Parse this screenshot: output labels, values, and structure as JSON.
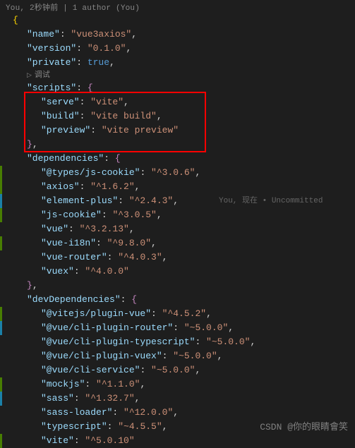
{
  "header": {
    "author_line": "You, 2秒钟前 | 1 author (You)"
  },
  "codelens": {
    "icon": "▷",
    "label": "调试"
  },
  "inline_blame": {
    "prefix": "You, 现在 ",
    "dot": "•",
    "suffix": " Uncommitted"
  },
  "json": {
    "name_key": "\"name\"",
    "name_val": "\"vue3axios\"",
    "version_key": "\"version\"",
    "version_val": "\"0.1.0\"",
    "private_key": "\"private\"",
    "private_val": "true",
    "scripts_key": "\"scripts\"",
    "serve_key": "\"serve\"",
    "serve_val": "\"vite\"",
    "build_key": "\"build\"",
    "build_val": "\"vite build\"",
    "preview_key": "\"preview\"",
    "preview_val": "\"vite preview\"",
    "dependencies_key": "\"dependencies\"",
    "dep_types_js_cookie_key": "\"@types/js-cookie\"",
    "dep_types_js_cookie_val": "\"^3.0.6\"",
    "dep_axios_key": "\"axios\"",
    "dep_axios_val": "\"^1.6.2\"",
    "dep_element_plus_key": "\"element-plus\"",
    "dep_element_plus_val": "\"^2.4.3\"",
    "dep_js_cookie_key": "\"js-cookie\"",
    "dep_js_cookie_val": "\"^3.0.5\"",
    "dep_vue_key": "\"vue\"",
    "dep_vue_val": "\"^3.2.13\"",
    "dep_vue_i18n_key": "\"vue-i18n\"",
    "dep_vue_i18n_val": "\"^9.8.0\"",
    "dep_vue_router_key": "\"vue-router\"",
    "dep_vue_router_val": "\"^4.0.3\"",
    "dep_vuex_key": "\"vuex\"",
    "dep_vuex_val": "\"^4.0.0\"",
    "devDependencies_key": "\"devDependencies\"",
    "dev_vitejs_plugin_vue_key": "\"@vitejs/plugin-vue\"",
    "dev_vitejs_plugin_vue_val": "\"^4.5.2\"",
    "dev_cli_plugin_router_key": "\"@vue/cli-plugin-router\"",
    "dev_cli_plugin_router_val": "\"~5.0.0\"",
    "dev_cli_plugin_typescript_key": "\"@vue/cli-plugin-typescript\"",
    "dev_cli_plugin_typescript_val": "\"~5.0.0\"",
    "dev_cli_plugin_vuex_key": "\"@vue/cli-plugin-vuex\"",
    "dev_cli_plugin_vuex_val": "\"~5.0.0\"",
    "dev_cli_service_key": "\"@vue/cli-service\"",
    "dev_cli_service_val": "\"~5.0.0\"",
    "dev_mockjs_key": "\"mockjs\"",
    "dev_mockjs_val": "\"^1.1.0\"",
    "dev_sass_key": "\"sass\"",
    "dev_sass_val": "\"^1.32.7\"",
    "dev_sass_loader_key": "\"sass-loader\"",
    "dev_sass_loader_val": "\"^12.0.0\"",
    "dev_typescript_key": "\"typescript\"",
    "dev_typescript_val": "\"~4.5.5\"",
    "dev_vite_key": "\"vite\"",
    "dev_vite_val": "\"^5.0.10\""
  },
  "watermark": "CSDN @你的眼睛會笑",
  "colors": {
    "redbox": "#ff0000"
  },
  "chart_data": null
}
